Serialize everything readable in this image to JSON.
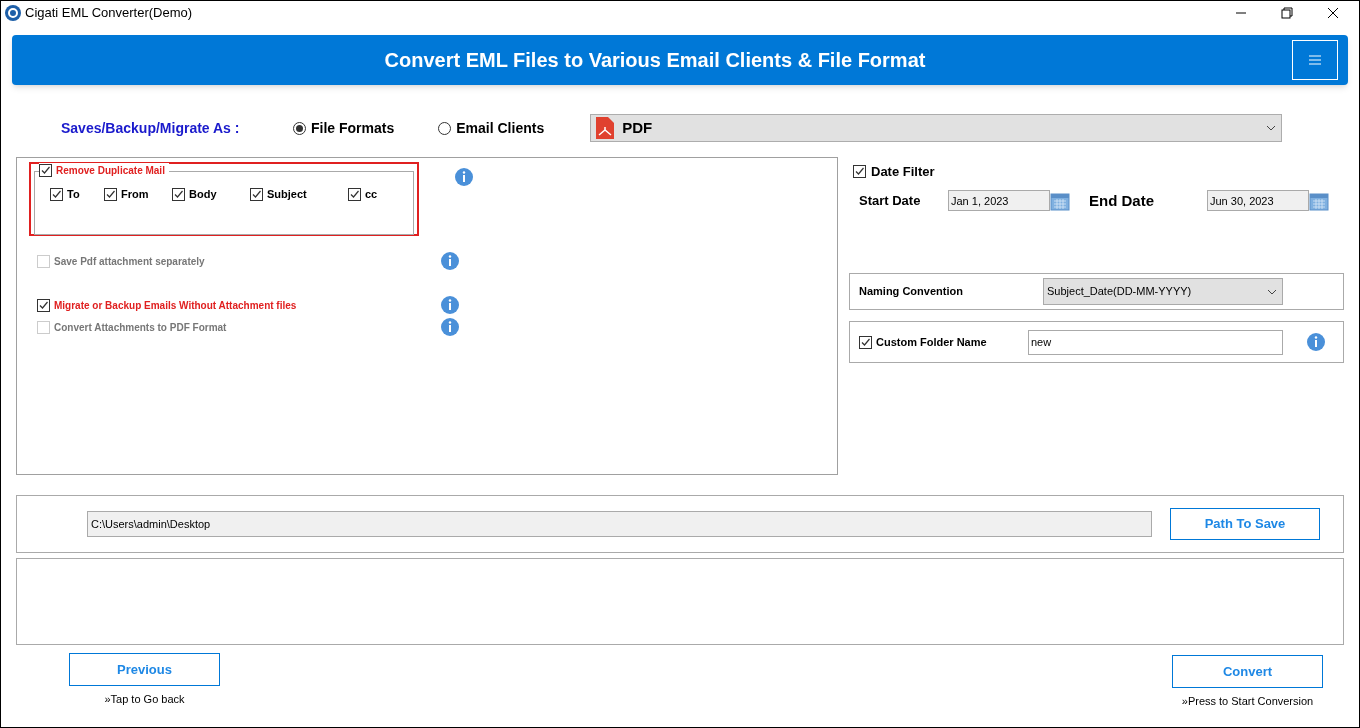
{
  "window": {
    "title": "Cigati EML Converter(Demo)"
  },
  "banner": {
    "title": "Convert EML Files to Various Email Clients & File Format"
  },
  "save_as": {
    "label": "Saves/Backup/Migrate As :",
    "options": [
      {
        "label": "File Formats",
        "selected": true
      },
      {
        "label": "Email Clients",
        "selected": false
      }
    ],
    "format": "PDF"
  },
  "duplicate": {
    "label": "Remove Duplicate Mail",
    "checked": true,
    "fields": [
      {
        "label": "To",
        "checked": true
      },
      {
        "label": "From",
        "checked": true
      },
      {
        "label": "Body",
        "checked": true
      },
      {
        "label": "Subject",
        "checked": true
      },
      {
        "label": "cc",
        "checked": true
      }
    ]
  },
  "options": [
    {
      "label": "Save Pdf attachment separately",
      "checked": false,
      "disabled": true
    },
    {
      "label": "Migrate or Backup Emails Without Attachment files",
      "checked": true,
      "disabled": false
    },
    {
      "label": "Convert Attachments to PDF Format",
      "checked": false,
      "disabled": true
    }
  ],
  "date_filter": {
    "label": "Date Filter",
    "checked": true,
    "start_label": "Start Date",
    "start": "Jan 1, 2023",
    "end_label": "End Date",
    "end": "Jun 30, 2023"
  },
  "naming": {
    "label": "Naming Convention",
    "value": "Subject_Date(DD-MM-YYYY)"
  },
  "custom_folder": {
    "label": "Custom Folder Name",
    "checked": true,
    "value": "new"
  },
  "path": {
    "value": "C:\\Users\\admin\\Desktop",
    "button": "Path To Save"
  },
  "footer": {
    "previous": "Previous",
    "previous_hint": "»Tap to Go back",
    "convert": "Convert",
    "convert_hint": "»Press to Start Conversion"
  }
}
